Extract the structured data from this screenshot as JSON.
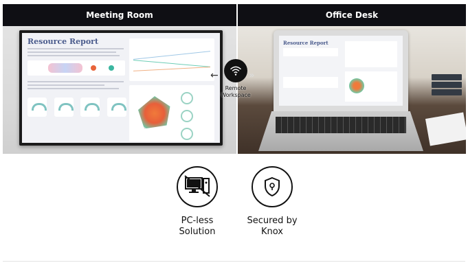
{
  "panels": {
    "left_title": "Meeting Room",
    "right_title": "Office Desk"
  },
  "report": {
    "title": "Resource Report"
  },
  "remote": {
    "label": "Remote\nWorkspace",
    "icon": "wifi-icon"
  },
  "features": [
    {
      "label": "PC-less\nSolution",
      "icon": "pc-less-icon"
    },
    {
      "label": "Secured by\nKnox",
      "icon": "shield-icon"
    }
  ],
  "colors": {
    "header_bg": "#0f0f14",
    "report_title": "#4a5b8c",
    "accent_orange": "#f07a3a",
    "accent_teal": "#6fc9a6"
  }
}
